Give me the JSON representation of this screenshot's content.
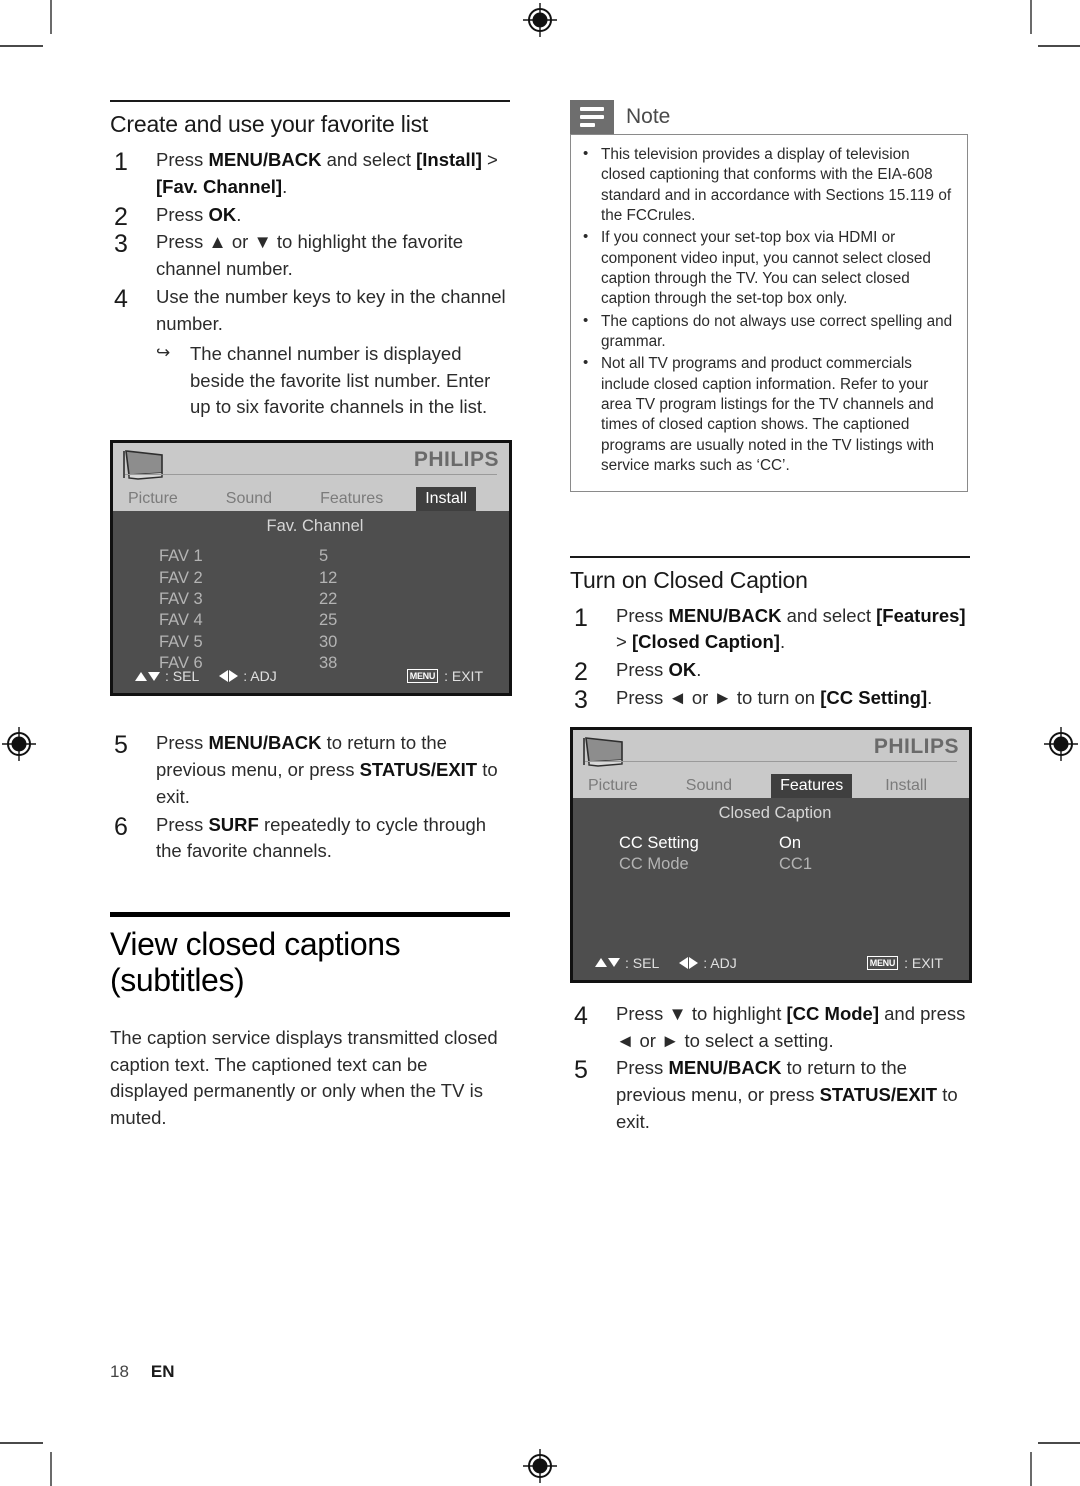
{
  "left_column": {
    "section_heading": "Create and use your favorite list",
    "steps": [
      {
        "num": "1",
        "html": "Press <b>MENU/BACK</b> and select <b>[Install]</b> &gt; <b>[Fav. Channel]</b>."
      },
      {
        "num": "2",
        "html": "Press <b>OK</b>."
      },
      {
        "num": "3",
        "html": "Press ▲ or ▼ to highlight the favorite channel number."
      },
      {
        "num": "4",
        "html": "Use the number keys to key in the channel number."
      }
    ],
    "substep": {
      "arrow": "↪",
      "text": "The channel number is displayed beside the favorite list number. Enter up to six favorite channels in the list."
    },
    "steps_after": [
      {
        "num": "5",
        "html": "Press <b>MENU/BACK</b> to return to the previous menu, or press <b>STATUS/EXIT</b> to exit."
      },
      {
        "num": "6",
        "html": "Press <b>SURF</b> repeatedly to cycle through the favorite channels."
      }
    ],
    "chapter_heading": "View closed captions (subtitles)",
    "chapter_body": "The caption service displays transmitted closed caption text. The captioned text can be displayed permanently or only when the TV is muted."
  },
  "osd_favorite": {
    "brand": "PHILIPS",
    "tabs": [
      {
        "label": "Picture",
        "active": false
      },
      {
        "label": "Sound",
        "active": false
      },
      {
        "label": "Features",
        "active": false
      },
      {
        "label": "Install",
        "active": true
      }
    ],
    "title": "Fav. Channel",
    "rows": [
      {
        "label": "FAV 1",
        "value": "5"
      },
      {
        "label": "FAV 2",
        "value": "12"
      },
      {
        "label": "FAV 3",
        "value": "22"
      },
      {
        "label": "FAV 4",
        "value": "25"
      },
      {
        "label": "FAV 5",
        "value": "30"
      },
      {
        "label": "FAV 6",
        "value": "38"
      }
    ],
    "footer": {
      "sel_label": ": SEL",
      "adj_label": ": ADJ",
      "menu_key": "MENU",
      "exit_label": ": EXIT"
    }
  },
  "note": {
    "title": "Note",
    "items": [
      "This television provides a display of television closed captioning that conforms with the EIA-608 standard and in accordance with Sections 15.119 of the FCCrules.",
      "If you connect your set-top box via HDMI or component video input, you cannot select closed caption through the TV. You can select closed caption through the set-top box only.",
      "The captions do not always use correct spelling and grammar.",
      "Not all TV programs and product commercials include closed caption information. Refer to your area TV program listings for the TV channels and times of closed caption shows. The captioned programs are usually noted in the TV listings with service marks such as ‘CC’."
    ]
  },
  "right_column": {
    "section_heading": "Turn on Closed Caption",
    "steps": [
      {
        "num": "1",
        "html": "Press <b>MENU/BACK</b> and select <b>[Features]</b> &gt; <b>[Closed Caption]</b>."
      },
      {
        "num": "2",
        "html": "Press <b>OK</b>."
      },
      {
        "num": "3",
        "html": "Press ◄ or ► to turn on <b>[CC Setting]</b>."
      }
    ],
    "steps_after": [
      {
        "num": "4",
        "html": "Press ▼ to highlight <b>[CC Mode]</b> and press ◄ or ► to select a setting."
      },
      {
        "num": "5",
        "html": "Press <b>MENU/BACK</b> to return to the previous menu, or press <b>STATUS/EXIT</b> to exit."
      }
    ]
  },
  "osd_caption": {
    "brand": "PHILIPS",
    "tabs": [
      {
        "label": "Picture",
        "active": false
      },
      {
        "label": "Sound",
        "active": false
      },
      {
        "label": "Features",
        "active": true
      },
      {
        "label": "Install",
        "active": false
      }
    ],
    "title": "Closed Caption",
    "rows": [
      {
        "label": "CC Setting",
        "value": "On",
        "highlighted": true
      },
      {
        "label": "CC Mode",
        "value": "CC1",
        "highlighted": false
      }
    ],
    "footer": {
      "sel_label": ": SEL",
      "adj_label": ": ADJ",
      "menu_key": "MENU",
      "exit_label": ": EXIT"
    }
  },
  "footer": {
    "page_number": "18",
    "language": "EN"
  },
  "colors": {
    "osd_header_bg": "#c9c9c9",
    "osd_body_bg": "#4e4e4e",
    "osd_tab_active_bg": "#3f3f3f",
    "note_icon_bg": "#6e6e6e",
    "text": "#2b2b2b"
  }
}
